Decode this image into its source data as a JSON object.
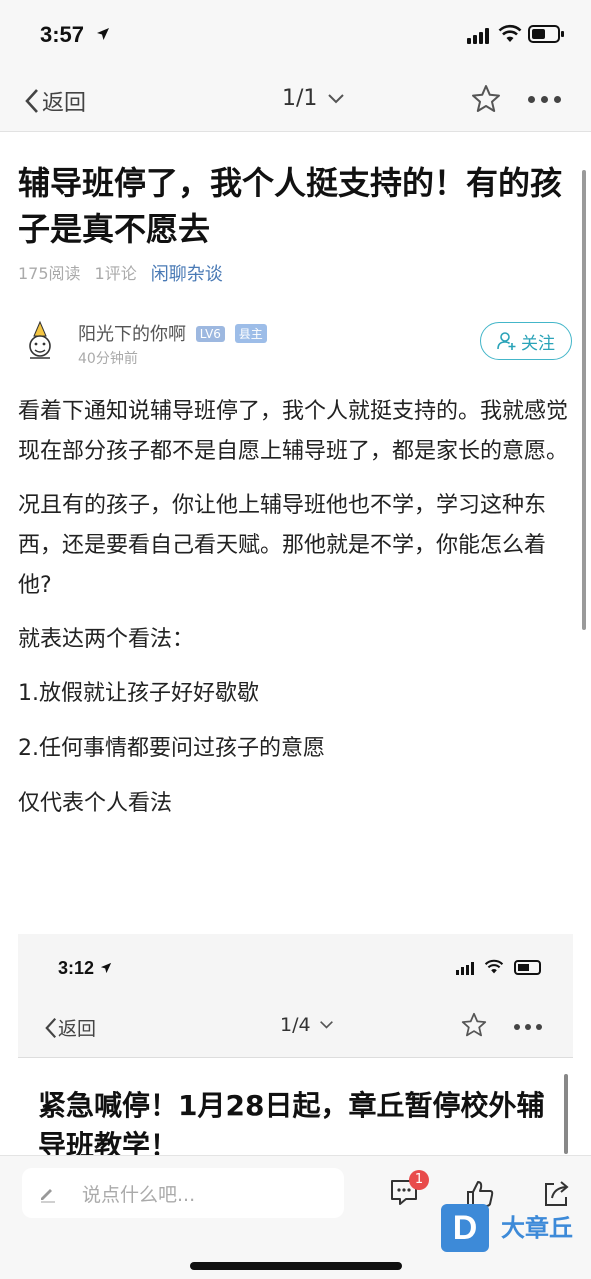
{
  "status_bar": {
    "time": "3:57"
  },
  "nav": {
    "back_label": "返回",
    "pager": "1/1"
  },
  "article": {
    "title": "辅导班停了，我个人挺支持的！有的孩子是真不愿去",
    "reads": "175阅读",
    "comments": "1评论",
    "category": "闲聊杂谈",
    "author": {
      "name": "阳光下的你啊",
      "level": "LV6",
      "role": "县主",
      "time": "40分钟前",
      "follow_label": "关注"
    },
    "paragraphs": [
      "看着下通知说辅导班停了，我个人就挺支持的。我就感觉现在部分孩子都不是自愿上辅导班了，都是家长的意愿。",
      "况且有的孩子，你让他上辅导班他也不学，学习这种东西，还是要看自己看天赋。那他就是不学，你能怎么着他?",
      "就表达两个看法：",
      "1.放假就让孩子好好歇歇",
      "2.任何事情都要问过孩子的意愿",
      "仅代表个人看法"
    ]
  },
  "embedded_screenshot": {
    "time": "3:12",
    "back_label": "返回",
    "pager": "1/4",
    "title": "紧急喊停！1月28日起，章丘暂停校外辅导班教学！"
  },
  "bottom_bar": {
    "comment_placeholder": "说点什么吧...",
    "comment_count": "1"
  },
  "watermark": {
    "logo": "D",
    "text": "大章丘"
  }
}
